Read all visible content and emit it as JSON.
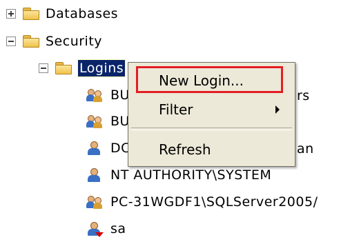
{
  "tree": {
    "databases": {
      "label": "Databases",
      "expander": "plus"
    },
    "security": {
      "label": "Security",
      "expander": "minus"
    },
    "logins": {
      "label": "Logins",
      "expander": "minus"
    },
    "login_items": [
      {
        "label": "BU",
        "icon": "group-user-icon"
      },
      {
        "label": "BU",
        "icon": "group-user-icon"
      },
      {
        "label": "DC",
        "icon": "user-icon"
      },
      {
        "label": "NT AUTHORITY\\SYSTEM",
        "icon": "user-icon"
      },
      {
        "label": "PC-31WGDF1\\SQLServer2005/",
        "icon": "group-user-icon"
      },
      {
        "label": "sa",
        "icon": "disabled-user-icon"
      }
    ],
    "behind_menu_text": [
      "rs",
      "an"
    ]
  },
  "context_menu": {
    "items": [
      {
        "label": "New Login..."
      },
      {
        "label": "Filter",
        "has_submenu": true
      },
      {
        "label": "Refresh"
      }
    ]
  },
  "colors": {
    "selection": "#0a246a",
    "highlight_box": "#e51c23",
    "menu_background": "#ece9d8"
  }
}
